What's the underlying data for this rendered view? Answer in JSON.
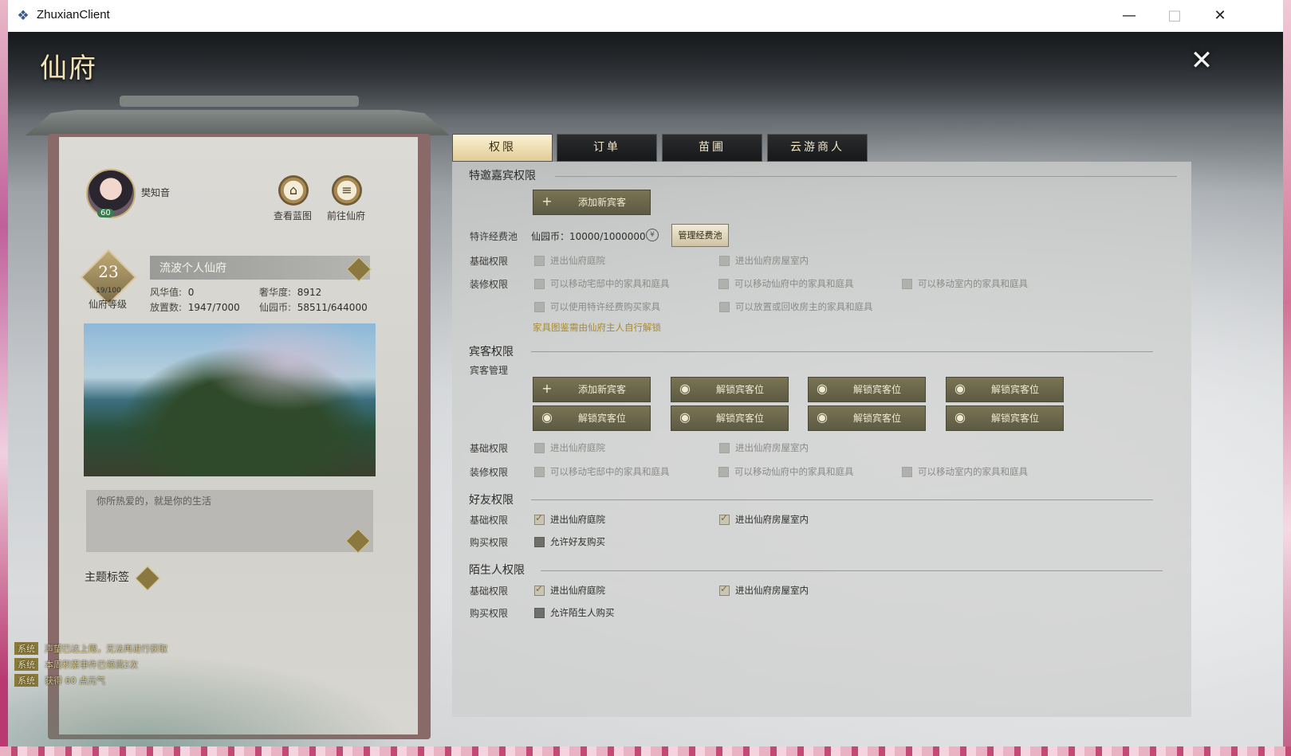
{
  "window": {
    "title": "ZhuxianClient",
    "app_icon": "zhuxian-app-icon",
    "controls": {
      "minimize": "—",
      "maximize": "□",
      "close": "✕"
    }
  },
  "page": {
    "title": "仙府",
    "close_glyph": "✕"
  },
  "profile": {
    "name": "樊知音",
    "avatar_level": "60",
    "blueprint_button": "查看蓝图",
    "goto_button": "前往仙府",
    "house_level": "23",
    "house_level_progress": "19/100",
    "house_level_label": "仙府等级",
    "house_name": "流波个人仙府",
    "stats": {
      "fenghua_label": "风华值:",
      "fenghua_value": "0",
      "shehua_label": "奢华度:",
      "shehua_value": "8912",
      "placed_label": "放置数:",
      "placed_value": "1947/7000",
      "coins_label": "仙园币:",
      "coins_value": "58511/644000"
    },
    "motto": "你所热爱的，就是你的生活",
    "theme_tag_label": "主题标签"
  },
  "system_messages": [
    {
      "tag": "系统",
      "text": "声望已达上限，无法再进行获取"
    },
    {
      "tag": "系统",
      "text": "本周积累事件已领满2次"
    },
    {
      "tag": "系统",
      "text": "获得 60 点元气"
    }
  ],
  "tabs": [
    {
      "label": "权限",
      "active": true
    },
    {
      "label": "订单",
      "active": false
    },
    {
      "label": "苗圃",
      "active": false
    },
    {
      "label": "云游商人",
      "active": false
    }
  ],
  "permissions": {
    "special_guest": {
      "title": "特邀嘉宾权限",
      "add_button": "添加新宾客",
      "pool_label": "特许经费池",
      "pool_coin_label": "仙园币：",
      "pool_value": "10000/1000000",
      "manage_button": "管理经费池",
      "basic_label": "基础权限",
      "basic": [
        "进出仙府庭院",
        "进出仙府房屋室内"
      ],
      "decor_label": "装修权限",
      "decor": [
        "可以移动宅邸中的家具和庭具",
        "可以移动仙府中的家具和庭具",
        "可以移动室内的家具和庭具",
        "可以使用特许经费购买家具",
        "可以放置或回收房主的家具和庭具"
      ],
      "note": "家具图鉴需由仙府主人自行解锁"
    },
    "guest": {
      "title": "宾客权限",
      "manage_label": "宾客管理",
      "add_button": "添加新宾客",
      "unlock_button": "解锁宾客位",
      "basic_label": "基础权限",
      "basic": [
        "进出仙府庭院",
        "进出仙府房屋室内"
      ],
      "decor_label": "装修权限",
      "decor": [
        "可以移动宅邸中的家具和庭具",
        "可以移动仙府中的家具和庭具",
        "可以移动室内的家具和庭具"
      ]
    },
    "friend": {
      "title": "好友权限",
      "basic_label": "基础权限",
      "basic": [
        "进出仙府庭院",
        "进出仙府房屋室内"
      ],
      "buy_label": "购买权限",
      "buy": "允许好友购买"
    },
    "stranger": {
      "title": "陌生人权限",
      "basic_label": "基础权限",
      "basic": [
        "进出仙府庭院",
        "进出仙府房屋室内"
      ],
      "buy_label": "购买权限",
      "buy": "允许陌生人购买"
    }
  },
  "colors": {
    "accent_gold": "#a88a2c",
    "button_olive": "#6b6749",
    "tab_active": "#f3e7c0"
  }
}
